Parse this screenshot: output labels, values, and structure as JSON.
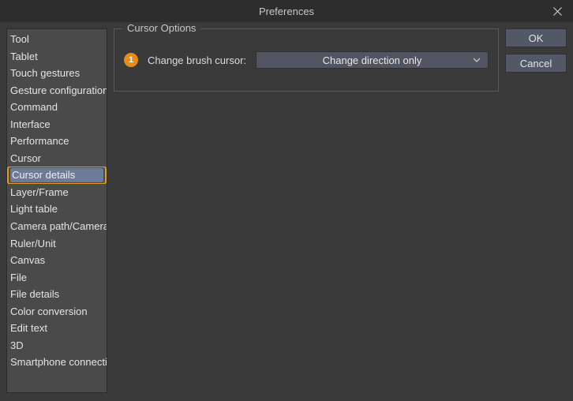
{
  "window": {
    "title": "Preferences"
  },
  "sidebar": {
    "items": [
      {
        "label": "Tool"
      },
      {
        "label": "Tablet"
      },
      {
        "label": "Touch gestures"
      },
      {
        "label": "Gesture configuration"
      },
      {
        "label": "Command"
      },
      {
        "label": "Interface"
      },
      {
        "label": "Performance"
      },
      {
        "label": "Cursor"
      },
      {
        "label": "Cursor details",
        "selected": true
      },
      {
        "label": "Layer/Frame"
      },
      {
        "label": "Light table"
      },
      {
        "label": "Camera path/Camera"
      },
      {
        "label": "Ruler/Unit"
      },
      {
        "label": "Canvas"
      },
      {
        "label": "File"
      },
      {
        "label": "File details"
      },
      {
        "label": "Color conversion"
      },
      {
        "label": "Edit text"
      },
      {
        "label": "3D"
      },
      {
        "label": "Smartphone connection"
      }
    ]
  },
  "group": {
    "legend": "Cursor Options",
    "callout": "1",
    "label": "Change brush cursor:",
    "dropdown_value": "Change direction only"
  },
  "buttons": {
    "ok": "OK",
    "cancel": "Cancel"
  }
}
